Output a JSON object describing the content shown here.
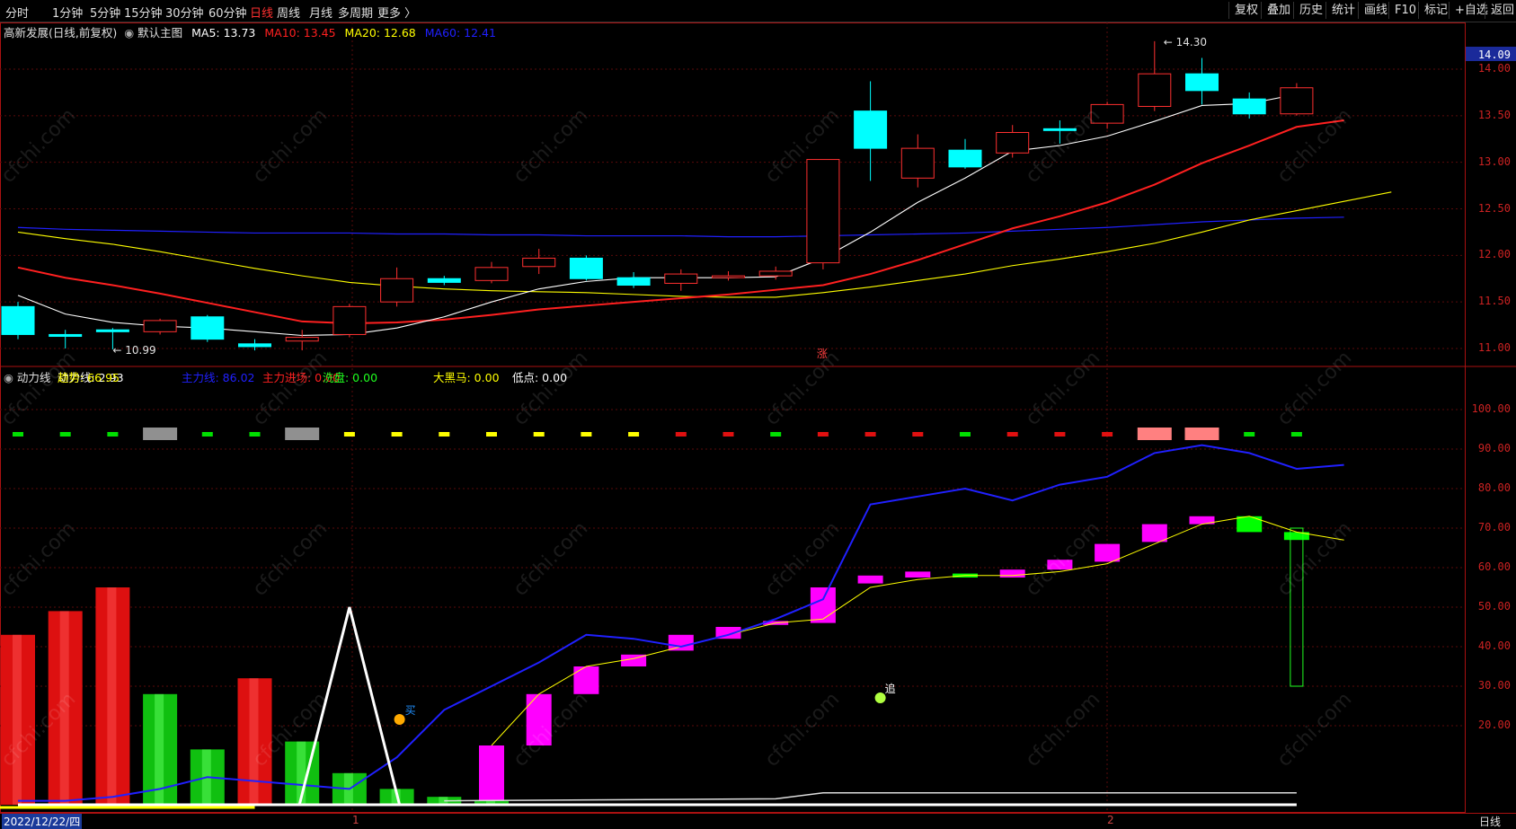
{
  "toolbar": {
    "periods": [
      "分时",
      "1分钟",
      "5分钟",
      "15分钟",
      "30分钟",
      "60分钟",
      "日线",
      "周线",
      "月线",
      "多周期",
      "更多 〉"
    ],
    "active_period": "日线",
    "right_buttons": [
      "复权",
      "叠加",
      "历史",
      "统计",
      "画线",
      "F10",
      "标记",
      "+自选",
      "返回"
    ]
  },
  "main_chart": {
    "title": "高新发展(日线,前复权)",
    "indicator": "默认主图",
    "ma_labels": [
      {
        "text": "MA5: 13.73",
        "color": "#ffffff"
      },
      {
        "text": "MA10: 13.45",
        "color": "#ff2020"
      },
      {
        "text": "MA20: 12.68",
        "color": "#ffff00"
      },
      {
        "text": "MA60: 12.41",
        "color": "#2020ff"
      }
    ],
    "current_price": "14.09",
    "y_ticks": [
      "14.00",
      "13.50",
      "13.00",
      "12.50",
      "12.00",
      "11.50",
      "11.00"
    ],
    "high_label": "14.30",
    "low_label": "10.99",
    "signal_label": "涨",
    "candles": [
      {
        "o": 11.45,
        "c": 11.15,
        "h": 11.5,
        "l": 11.1
      },
      {
        "o": 11.15,
        "c": 11.13,
        "h": 11.2,
        "l": 11.0
      },
      {
        "o": 11.2,
        "c": 11.18,
        "h": 11.22,
        "l": 10.99
      },
      {
        "o": 11.18,
        "c": 11.3,
        "h": 11.32,
        "l": 11.15
      },
      {
        "o": 11.34,
        "c": 11.1,
        "h": 11.36,
        "l": 11.07
      },
      {
        "o": 11.05,
        "c": 11.02,
        "h": 11.1,
        "l": 10.98
      },
      {
        "o": 11.08,
        "c": 11.12,
        "h": 11.2,
        "l": 10.98
      },
      {
        "o": 11.15,
        "c": 11.45,
        "h": 11.48,
        "l": 11.12
      },
      {
        "o": 11.5,
        "c": 11.75,
        "h": 11.87,
        "l": 11.45
      },
      {
        "o": 11.75,
        "c": 11.71,
        "h": 11.78,
        "l": 11.68
      },
      {
        "o": 11.73,
        "c": 11.87,
        "h": 11.93,
        "l": 11.7
      },
      {
        "o": 11.88,
        "c": 11.97,
        "h": 12.07,
        "l": 11.8
      },
      {
        "o": 11.97,
        "c": 11.75,
        "h": 12.0,
        "l": 11.73
      },
      {
        "o": 11.76,
        "c": 11.68,
        "h": 11.82,
        "l": 11.65
      },
      {
        "o": 11.7,
        "c": 11.8,
        "h": 11.85,
        "l": 11.62
      },
      {
        "o": 11.78,
        "c": 11.78,
        "h": 11.83,
        "l": 11.73
      },
      {
        "o": 11.78,
        "c": 11.83,
        "h": 11.88,
        "l": 11.74
      },
      {
        "o": 11.92,
        "c": 13.03,
        "h": 13.03,
        "l": 11.85
      },
      {
        "o": 13.55,
        "c": 13.15,
        "h": 13.87,
        "l": 12.8
      },
      {
        "o": 12.83,
        "c": 13.15,
        "h": 13.3,
        "l": 12.73
      },
      {
        "o": 13.13,
        "c": 12.95,
        "h": 13.25,
        "l": 12.93
      },
      {
        "o": 13.1,
        "c": 13.32,
        "h": 13.4,
        "l": 13.05
      },
      {
        "o": 13.36,
        "c": 13.35,
        "h": 13.45,
        "l": 13.2
      },
      {
        "o": 13.42,
        "c": 13.62,
        "h": 13.65,
        "l": 13.36
      },
      {
        "o": 13.6,
        "c": 13.95,
        "h": 14.3,
        "l": 13.55
      },
      {
        "o": 13.95,
        "c": 13.77,
        "h": 14.12,
        "l": 13.62
      },
      {
        "o": 13.68,
        "c": 13.52,
        "h": 13.75,
        "l": 13.47
      },
      {
        "o": 13.52,
        "c": 13.8,
        "h": 13.85,
        "l": 13.5
      }
    ],
    "ma5": [
      11.57,
      11.37,
      11.28,
      11.24,
      11.22,
      11.18,
      11.14,
      11.15,
      11.22,
      11.34,
      11.5,
      11.64,
      11.72,
      11.76,
      11.76,
      11.76,
      11.77,
      11.97,
      12.25,
      12.57,
      12.83,
      13.12,
      13.18,
      13.28,
      13.44,
      13.61,
      13.63,
      13.73
    ],
    "ma10": [
      11.87,
      11.76,
      11.68,
      11.59,
      11.49,
      11.39,
      11.29,
      11.27,
      11.28,
      11.31,
      11.36,
      11.42,
      11.46,
      11.5,
      11.54,
      11.58,
      11.63,
      11.68,
      11.8,
      11.95,
      12.12,
      12.29,
      12.42,
      12.57,
      12.76,
      12.99,
      13.18,
      13.38,
      13.45
    ],
    "ma20": [
      12.25,
      12.18,
      12.12,
      12.04,
      11.95,
      11.86,
      11.78,
      11.71,
      11.67,
      11.64,
      11.62,
      11.61,
      11.6,
      11.58,
      11.56,
      11.55,
      11.55,
      11.6,
      11.66,
      11.73,
      11.8,
      11.89,
      11.96,
      12.04,
      12.13,
      12.25,
      12.38,
      12.48,
      12.58,
      12.68
    ],
    "ma60": [
      12.3,
      12.28,
      12.27,
      12.26,
      12.25,
      12.24,
      12.24,
      12.24,
      12.23,
      12.23,
      12.22,
      12.22,
      12.21,
      12.21,
      12.21,
      12.2,
      12.2,
      12.21,
      12.22,
      12.23,
      12.24,
      12.26,
      12.28,
      12.3,
      12.33,
      12.36,
      12.38,
      12.4,
      12.41
    ]
  },
  "sub_chart": {
    "name": "动力线",
    "labels": [
      {
        "text": "动力线: 2.93",
        "color": "#ffffff"
      },
      {
        "text": "趋势: 66.95",
        "color": "#ffff00"
      },
      {
        "text": "主力线: 86.02",
        "color": "#2020ff"
      },
      {
        "text": "主力进场: 0.00",
        "color": "#ff2020"
      },
      {
        "text": "洗盘: 0.00",
        "color": "#20ff20"
      },
      {
        "text": "大黑马: 0.00",
        "color": "#ffff00"
      },
      {
        "text": "低点: 0.00",
        "color": "#ffffff"
      }
    ],
    "y_ticks": [
      "100.00",
      "90.00",
      "80.00",
      "70.00",
      "60.00",
      "50.00",
      "40.00",
      "30.00",
      "20.00"
    ],
    "buy_label": "买",
    "chase_label": "追",
    "dot_colors": [
      "#00e000",
      "#00e000",
      "#00e000",
      "#909090",
      "#00e000",
      "#00e000",
      "#909090",
      "#ffff00",
      "#ffff00",
      "#ffff00",
      "#ffff00",
      "#ffff00",
      "#ffff00",
      "#ffff00",
      "#e01010",
      "#e01010",
      "#00e000",
      "#e01010",
      "#e01010",
      "#e01010",
      "#00e000",
      "#e01010",
      "#e01010",
      "#e01010",
      "#ff8080",
      "#ff8080",
      "#00e000",
      "#00e000"
    ],
    "bars": [
      {
        "v": 43,
        "color": "red"
      },
      {
        "v": 49,
        "color": "red"
      },
      {
        "v": 55,
        "color": "red"
      },
      {
        "v": 28,
        "color": "green"
      },
      {
        "v": 14,
        "color": "green"
      },
      {
        "v": 32,
        "color": "red"
      },
      {
        "v": 16,
        "color": "green"
      },
      {
        "v": 8,
        "color": "green"
      },
      {
        "v": 4,
        "color": "green"
      },
      {
        "v": 2,
        "color": "green"
      },
      {
        "v": 1,
        "color": "green"
      }
    ],
    "main_line": [
      1,
      1,
      2,
      4,
      7,
      6,
      5,
      4,
      12,
      24,
      30,
      36,
      43,
      42,
      40,
      43,
      47,
      52,
      76,
      78,
      80,
      77,
      81,
      83,
      89,
      91,
      89,
      85,
      86
    ],
    "trend_line": [
      null,
      null,
      null,
      null,
      null,
      null,
      null,
      null,
      null,
      null,
      15,
      28,
      35,
      37,
      40,
      43,
      46,
      47,
      55,
      57,
      58,
      58,
      59,
      61,
      66,
      71,
      73,
      69,
      67
    ],
    "trend_boxes": [
      {
        "i": 10,
        "top": 15,
        "bot": 1,
        "color": "#ff00ff"
      },
      {
        "i": 11,
        "top": 28,
        "bot": 15,
        "color": "#ff00ff"
      },
      {
        "i": 12,
        "top": 35,
        "bot": 28,
        "color": "#ff00ff"
      },
      {
        "i": 13,
        "top": 38,
        "bot": 35,
        "color": "#ff00ff"
      },
      {
        "i": 14,
        "top": 43,
        "bot": 39,
        "color": "#ff00ff"
      },
      {
        "i": 15,
        "top": 45,
        "bot": 42,
        "color": "#ff00ff"
      },
      {
        "i": 16,
        "top": 46.5,
        "bot": 45.5,
        "color": "#ff00ff"
      },
      {
        "i": 17,
        "top": 55,
        "bot": 46,
        "color": "#ff00ff"
      },
      {
        "i": 18,
        "top": 58,
        "bot": 56,
        "color": "#ff00ff"
      },
      {
        "i": 19,
        "top": 59,
        "bot": 57.5,
        "color": "#ff00ff"
      },
      {
        "i": 20,
        "top": 58.5,
        "bot": 57.5,
        "color": "#00ff00"
      },
      {
        "i": 21,
        "top": 59.5,
        "bot": 57.5,
        "color": "#ff00ff"
      },
      {
        "i": 22,
        "top": 62,
        "bot": 59.5,
        "color": "#ff00ff"
      },
      {
        "i": 23,
        "top": 66,
        "bot": 61.5,
        "color": "#ff00ff"
      },
      {
        "i": 24,
        "top": 71,
        "bot": 66.5,
        "color": "#ff00ff"
      },
      {
        "i": 25,
        "top": 73,
        "bot": 71,
        "color": "#ff00ff"
      },
      {
        "i": 26,
        "top": 73,
        "bot": 69,
        "color": "#00ff00"
      },
      {
        "i": 27,
        "top": 69,
        "bot": 67,
        "color": "#00ff00"
      }
    ],
    "white_peak": {
      "i": 7,
      "v": 50
    }
  },
  "footer": {
    "date": "2022/12/22/四",
    "months": [
      "1",
      "2"
    ],
    "period": "日线"
  },
  "watermark": "cfchi.com"
}
